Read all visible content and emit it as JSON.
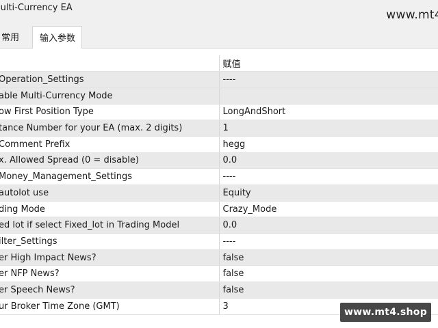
{
  "window": {
    "title": "lulti-Currency EA",
    "watermark_top": "www.mt4"
  },
  "tabs": [
    {
      "label": "常用",
      "active": false
    },
    {
      "label": "输入参数",
      "active": true
    }
  ],
  "table": {
    "columns": [
      "",
      "赋值"
    ],
    "rows": [
      {
        "name": "Operation_Settings",
        "value": "----"
      },
      {
        "name": "able Multi-Currency Mode",
        "value": ""
      },
      {
        "name": "ow First Position Type",
        "value": "LongAndShort"
      },
      {
        "name": "tance Number for your EA (max. 2 digits)",
        "value": "1"
      },
      {
        "name": " Comment Prefix",
        "value": "hegg"
      },
      {
        "name": "x. Allowed Spread (0 = disable)",
        "value": "0.0"
      },
      {
        "name": "Money_Management_Settings",
        "value": "----"
      },
      {
        "name": " autolot use",
        "value": "Equity"
      },
      {
        "name": "ding Mode",
        "value": "Crazy_Mode"
      },
      {
        "name": "ed lot if select Fixed_lot in Trading Model",
        "value": "0.0"
      },
      {
        "name": "ilter_Settings",
        "value": "----"
      },
      {
        "name": "er High Impact News?",
        "value": "false"
      },
      {
        "name": "er NFP News?",
        "value": "false"
      },
      {
        "name": "er Speech News?",
        "value": "false"
      },
      {
        "name": "ur Broker Time Zone (GMT)",
        "value": "3"
      }
    ]
  },
  "watermark_bottom": "www.mt4.shop"
}
